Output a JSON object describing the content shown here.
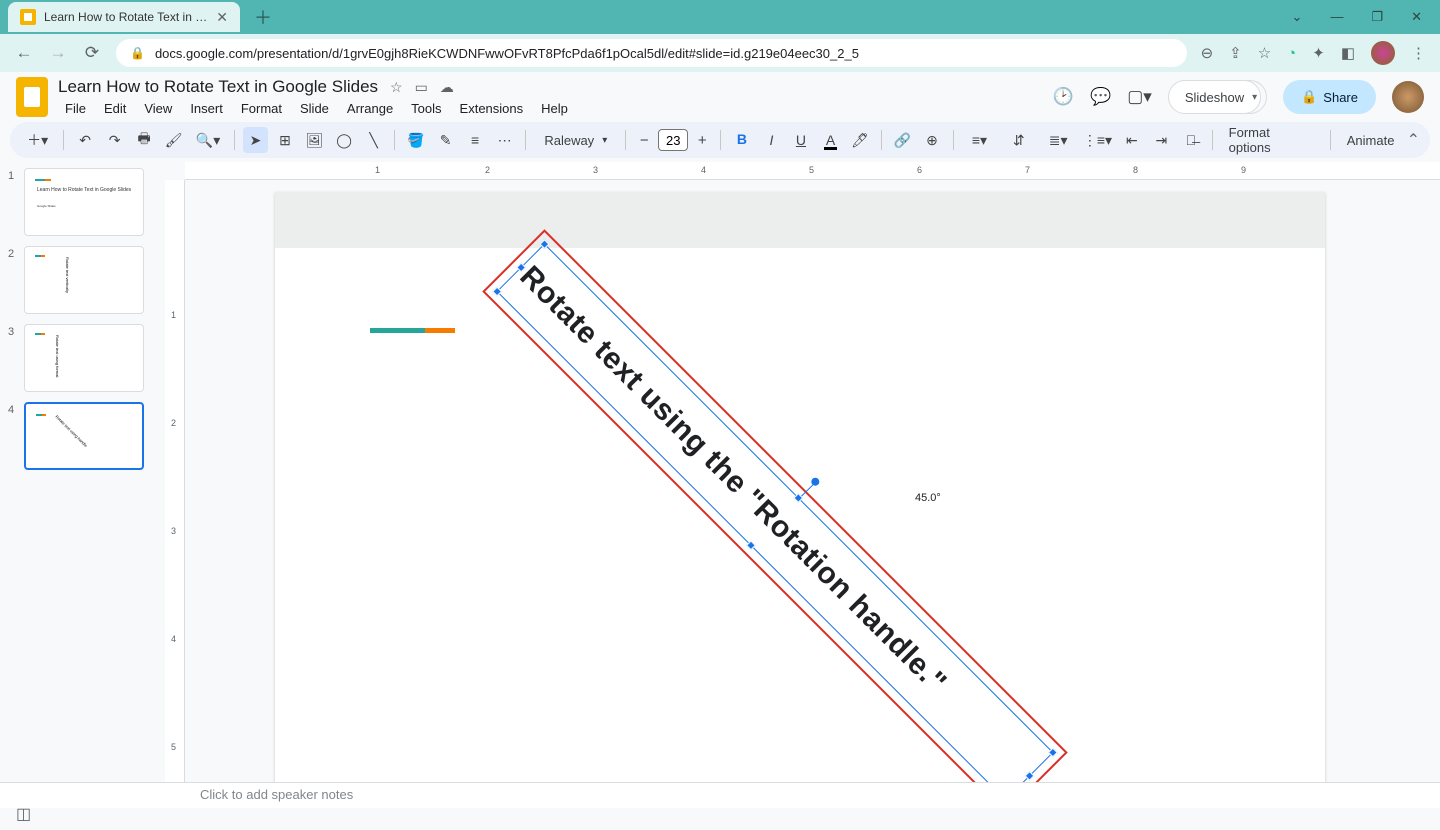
{
  "browser": {
    "tab_title": "Learn How to Rotate Text in Goo",
    "url": "docs.google.com/presentation/d/1grvE0gjh8RieKCWDNFwwOFvRT8PfcPda6f1pOcal5dl/edit#slide=id.g219e04eec30_2_5"
  },
  "doc": {
    "title": "Learn How to Rotate Text in Google Slides",
    "menus": [
      "File",
      "Edit",
      "View",
      "Insert",
      "Format",
      "Slide",
      "Arrange",
      "Tools",
      "Extensions",
      "Help"
    ]
  },
  "header": {
    "slideshow": "Slideshow",
    "share": "Share"
  },
  "toolbar": {
    "font": "Raleway",
    "font_size": "23",
    "format_options": "Format options",
    "animate": "Animate"
  },
  "slides": {
    "nums": [
      "1",
      "2",
      "3",
      "4"
    ],
    "thumb1_title": "Learn How to Rotate Text in Google Slides",
    "thumb1_sub": "Google Slides"
  },
  "canvas": {
    "rotated_text": "Rotate text using the \"Rotation handle.\"",
    "angle": "45.0°"
  },
  "notes": {
    "placeholder": "Click to add speaker notes"
  },
  "ruler_h": [
    "1",
    "2",
    "3",
    "4",
    "5",
    "6",
    "7",
    "8",
    "9"
  ],
  "ruler_v": [
    "1",
    "2",
    "3",
    "4",
    "5"
  ]
}
